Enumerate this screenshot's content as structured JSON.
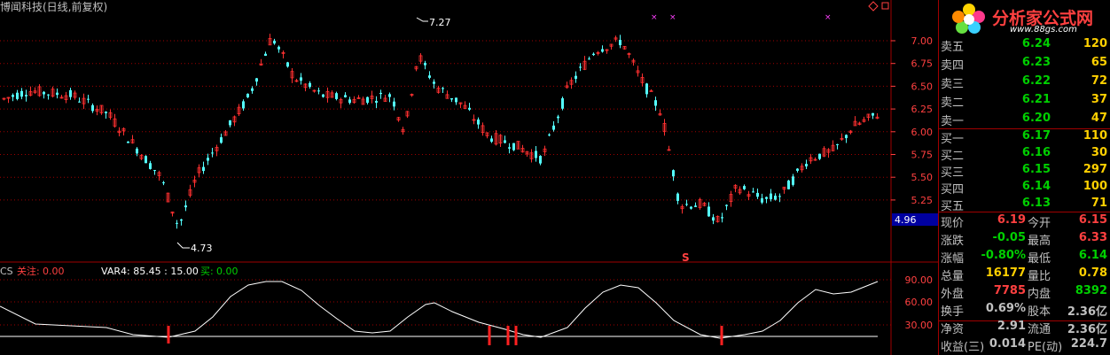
{
  "header": {
    "title": "博闻科技(日线,前复权)",
    "high_marker": "7.27",
    "low_marker": "4.73"
  },
  "main_axis": {
    "ticks": [
      "7.00",
      "6.75",
      "6.50",
      "6.25",
      "6.00",
      "5.75",
      "5.50",
      "5.25"
    ],
    "current_label": "4.96",
    "signal": "S"
  },
  "indicator": {
    "name": "CS",
    "guanzhu_label": "关注:",
    "guanzhu_value": "0.00",
    "var4_text": "VAR4: 85.45 : 15.00",
    "buy_label": "买:",
    "buy_value": "0.00",
    "ticks": [
      "90.00",
      "60.00",
      "30.00"
    ]
  },
  "order_book": {
    "sell": [
      {
        "label": "卖五",
        "price": "6.24",
        "vol": "120"
      },
      {
        "label": "卖四",
        "price": "6.23",
        "vol": "65"
      },
      {
        "label": "卖三",
        "price": "6.22",
        "vol": "72"
      },
      {
        "label": "卖二",
        "price": "6.21",
        "vol": "37"
      },
      {
        "label": "卖一",
        "price": "6.20",
        "vol": "47"
      }
    ],
    "buy": [
      {
        "label": "买一",
        "price": "6.17",
        "vol": "110"
      },
      {
        "label": "买二",
        "price": "6.16",
        "vol": "30"
      },
      {
        "label": "买三",
        "price": "6.15",
        "vol": "297"
      },
      {
        "label": "买四",
        "price": "6.14",
        "vol": "100"
      },
      {
        "label": "买五",
        "price": "6.13",
        "vol": "71"
      }
    ]
  },
  "quote": [
    {
      "l1": "现价",
      "v1": "6.19",
      "l2": "今开",
      "v2": "6.15",
      "c1": "#ff4040",
      "c2": "#ff4040"
    },
    {
      "l1": "涨跌",
      "v1": "-0.05",
      "l2": "最高",
      "v2": "6.33",
      "c1": "#00d000",
      "c2": "#ff4040"
    },
    {
      "l1": "涨幅",
      "v1": "-0.80%",
      "l2": "最低",
      "v2": "6.14",
      "c1": "#00d000",
      "c2": "#00d000"
    },
    {
      "l1": "总量",
      "v1": "16177",
      "l2": "量比",
      "v2": "0.78",
      "c1": "#ffd000",
      "c2": "#ffd000"
    },
    {
      "l1": "外盘",
      "v1": "7785",
      "l2": "内盘",
      "v2": "8392",
      "c1": "#ff4040",
      "c2": "#00d000"
    },
    {
      "l1": "换手",
      "v1": "0.69%",
      "l2": "股本",
      "v2": "2.36亿",
      "c1": "#c0c0c0",
      "c2": "#c0c0c0"
    },
    {
      "l1": "净资",
      "v1": "2.91",
      "l2": "流通",
      "v2": "2.36亿",
      "c1": "#c0c0c0",
      "c2": "#c0c0c0"
    },
    {
      "l1": "收益(三)",
      "v1": "0.014",
      "l2": "PE(动)",
      "v2": "224.7",
      "c1": "#c0c0c0",
      "c2": "#c0c0c0"
    }
  ],
  "logo": {
    "name": "分析家公式网",
    "url": "www.88gs.com"
  },
  "colors": {
    "up": "#ff3030",
    "down": "#54ffff",
    "grid": "#a00000",
    "axis": "#ff4040"
  }
}
